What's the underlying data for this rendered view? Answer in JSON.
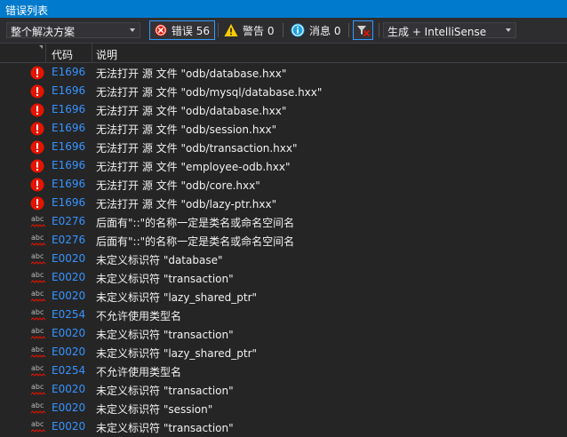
{
  "window": {
    "title": "错误列表"
  },
  "toolbar": {
    "scope": {
      "value": "整个解决方案"
    },
    "errors": {
      "label": "错误 56"
    },
    "warnings": {
      "label": "警告 0"
    },
    "messages": {
      "label": "消息 0"
    },
    "filter_icon": "filter-icon",
    "build_filter": {
      "value": "生成 + IntelliSense"
    }
  },
  "columns": {
    "code": "代码",
    "description": "说明"
  },
  "colors": {
    "accent": "#007acc",
    "error": "#e51400",
    "code_link": "#3794ff",
    "squiggle": "#e51400"
  },
  "rows": [
    {
      "icon": "error-icon",
      "code": "E1696",
      "description": "无法打开 源 文件 \"odb/database.hxx\""
    },
    {
      "icon": "error-icon",
      "code": "E1696",
      "description": "无法打开 源 文件 \"odb/mysql/database.hxx\""
    },
    {
      "icon": "error-icon",
      "code": "E1696",
      "description": "无法打开 源 文件 \"odb/database.hxx\""
    },
    {
      "icon": "error-icon",
      "code": "E1696",
      "description": "无法打开 源 文件 \"odb/session.hxx\""
    },
    {
      "icon": "error-icon",
      "code": "E1696",
      "description": "无法打开 源 文件 \"odb/transaction.hxx\""
    },
    {
      "icon": "error-icon",
      "code": "E1696",
      "description": "无法打开 源 文件 \"employee-odb.hxx\""
    },
    {
      "icon": "error-icon",
      "code": "E1696",
      "description": "无法打开 源 文件 \"odb/core.hxx\""
    },
    {
      "icon": "error-icon",
      "code": "E1696",
      "description": "无法打开 源 文件 \"odb/lazy-ptr.hxx\""
    },
    {
      "icon": "intellisense-squiggle-icon",
      "code": "E0276",
      "description": "后面有\"::\"的名称一定是类名或命名空间名"
    },
    {
      "icon": "intellisense-squiggle-icon",
      "code": "E0276",
      "description": "后面有\"::\"的名称一定是类名或命名空间名"
    },
    {
      "icon": "intellisense-squiggle-icon",
      "code": "E0020",
      "description": "未定义标识符 \"database\""
    },
    {
      "icon": "intellisense-squiggle-icon",
      "code": "E0020",
      "description": "未定义标识符 \"transaction\""
    },
    {
      "icon": "intellisense-squiggle-icon",
      "code": "E0020",
      "description": "未定义标识符 \"lazy_shared_ptr\""
    },
    {
      "icon": "intellisense-squiggle-icon",
      "code": "E0254",
      "description": "不允许使用类型名"
    },
    {
      "icon": "intellisense-squiggle-icon",
      "code": "E0020",
      "description": "未定义标识符 \"transaction\""
    },
    {
      "icon": "intellisense-squiggle-icon",
      "code": "E0020",
      "description": "未定义标识符 \"lazy_shared_ptr\""
    },
    {
      "icon": "intellisense-squiggle-icon",
      "code": "E0254",
      "description": "不允许使用类型名"
    },
    {
      "icon": "intellisense-squiggle-icon",
      "code": "E0020",
      "description": "未定义标识符 \"transaction\""
    },
    {
      "icon": "intellisense-squiggle-icon",
      "code": "E0020",
      "description": "未定义标识符 \"session\""
    },
    {
      "icon": "intellisense-squiggle-icon",
      "code": "E0020",
      "description": "未定义标识符 \"transaction\""
    }
  ]
}
